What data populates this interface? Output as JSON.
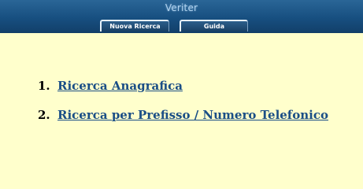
{
  "header": {
    "logo_text": "Veriter"
  },
  "tabs": [
    {
      "label": "Nuova Ricerca"
    },
    {
      "label": "Guida"
    }
  ],
  "links": [
    {
      "number": "1.",
      "label": "Ricerca Anagrafica"
    },
    {
      "number": "2.",
      "label": "Ricerca per Prefisso / Numero Telefonico"
    }
  ],
  "colors": {
    "header_bg": "#174f80",
    "page_bg": "#ffffcc",
    "link": "#1a4e86",
    "tab_border": "#e8f2fb"
  }
}
